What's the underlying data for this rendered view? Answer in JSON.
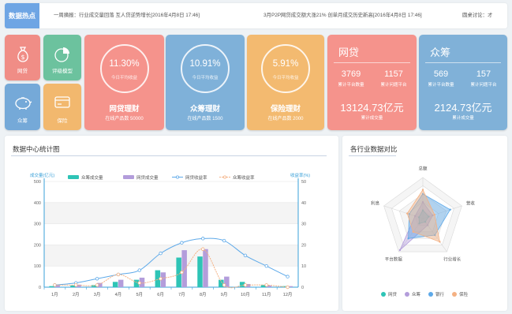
{
  "ticker": {
    "label": "数据热点",
    "items": [
      "一周摘报：行业成交量回落 互人贷逆势增长[2016年4月8日 17:46]",
      "3月P2P网贷成交额大涨21% 创单月成交历史新高[2016年4月8日 17:46]",
      "圆桌讨论：才"
    ]
  },
  "tiles": [
    {
      "label": "网贷",
      "color": "#f08d86",
      "icon": "money-bag-icon"
    },
    {
      "label": "评级模型",
      "color": "#6cc29e",
      "icon": "pie-chart-icon"
    },
    {
      "label": "众筹",
      "color": "#75a9d8",
      "icon": "piggy-bank-icon"
    },
    {
      "label": "保险",
      "color": "#f2b86e",
      "icon": "card-icon"
    }
  ],
  "rates": [
    {
      "pct": "11.30%",
      "cap": "今日平均收益",
      "name": "网贷理财",
      "sub": "在线产品数 50000",
      "color": "#f5938c"
    },
    {
      "pct": "10.91%",
      "cap": "今日平均收益",
      "name": "众筹理财",
      "sub": "在线产品数 1500",
      "color": "#7fb1d9"
    },
    {
      "pct": "5.91%",
      "cap": "今日平均收益",
      "name": "保险理财",
      "sub": "在线产品数 2000",
      "color": "#f3ba70"
    }
  ],
  "stats": [
    {
      "title": "网贷",
      "n1": "3769",
      "c1": "累计平台数量",
      "n2": "1157",
      "c2": "累计问题平台",
      "big": "13124.73亿元",
      "bigc": "累计成交量",
      "color": "#f5938c"
    },
    {
      "title": "众筹",
      "n1": "569",
      "c1": "累计平台数量",
      "n2": "157",
      "c2": "累计问题平台",
      "big": "2124.73亿元",
      "bigc": "累计成交量",
      "color": "#80b1d8"
    }
  ],
  "left_panel": {
    "title": "数据中心统计图"
  },
  "right_panel": {
    "title": "各行业数据对比"
  },
  "colors": {
    "teal": "#2ec4b6",
    "purple": "#b39ddb",
    "blue": "#5da9e9",
    "orange": "#f4b183"
  },
  "chart_data": [
    {
      "type": "bar",
      "legend": [
        "众筹成交量",
        "网贷成交量",
        "网贷收益率",
        "众筹收益率"
      ],
      "y_left_label": "成交量(亿元)",
      "y_right_label": "收益率(%)",
      "ylim_left": [
        0,
        500
      ],
      "ylim_right": [
        0,
        50
      ],
      "y_left_ticks": [
        "0",
        "100",
        "200",
        "300",
        "400",
        "500"
      ],
      "y_right_ticks": [
        "0",
        "10",
        "20",
        "30",
        "40",
        "50"
      ],
      "categories": [
        "1月",
        "2月",
        "3月",
        "4月",
        "5月",
        "6月",
        "7月",
        "8月",
        "9月",
        "10月",
        "11月",
        "12月"
      ],
      "series": [
        {
          "name": "众筹成交量",
          "kind": "bar",
          "axis": "left",
          "values": [
            5,
            8,
            10,
            25,
            35,
            80,
            140,
            145,
            35,
            25,
            10,
            5
          ]
        },
        {
          "name": "网贷成交量",
          "kind": "bar",
          "axis": "left",
          "values": [
            10,
            12,
            20,
            35,
            45,
            70,
            175,
            180,
            50,
            15,
            8,
            5
          ]
        },
        {
          "name": "网贷收益率",
          "kind": "line",
          "axis": "right",
          "values": [
            1,
            2,
            4,
            6,
            8,
            16,
            21,
            23,
            22,
            15,
            10,
            5
          ]
        },
        {
          "name": "众筹收益率",
          "kind": "line",
          "axis": "right",
          "values": [
            1,
            1,
            1,
            6,
            2,
            4,
            7,
            18,
            1,
            1,
            1,
            0
          ]
        }
      ]
    },
    {
      "type": "radar",
      "indicators": [
        "总额",
        "营收",
        "行业增长",
        "平台数据",
        "利息"
      ],
      "max": 100,
      "legend": [
        "网贷",
        "众筹",
        "银行",
        "保险"
      ],
      "series": [
        {
          "name": "网贷",
          "values": [
            20,
            15,
            10,
            15,
            10
          ]
        },
        {
          "name": "众筹",
          "values": [
            40,
            25,
            20,
            95,
            20
          ]
        },
        {
          "name": "银行",
          "values": [
            60,
            70,
            50,
            60,
            35
          ]
        },
        {
          "name": "保险",
          "values": [
            70,
            30,
            70,
            40,
            40
          ]
        }
      ]
    }
  ]
}
